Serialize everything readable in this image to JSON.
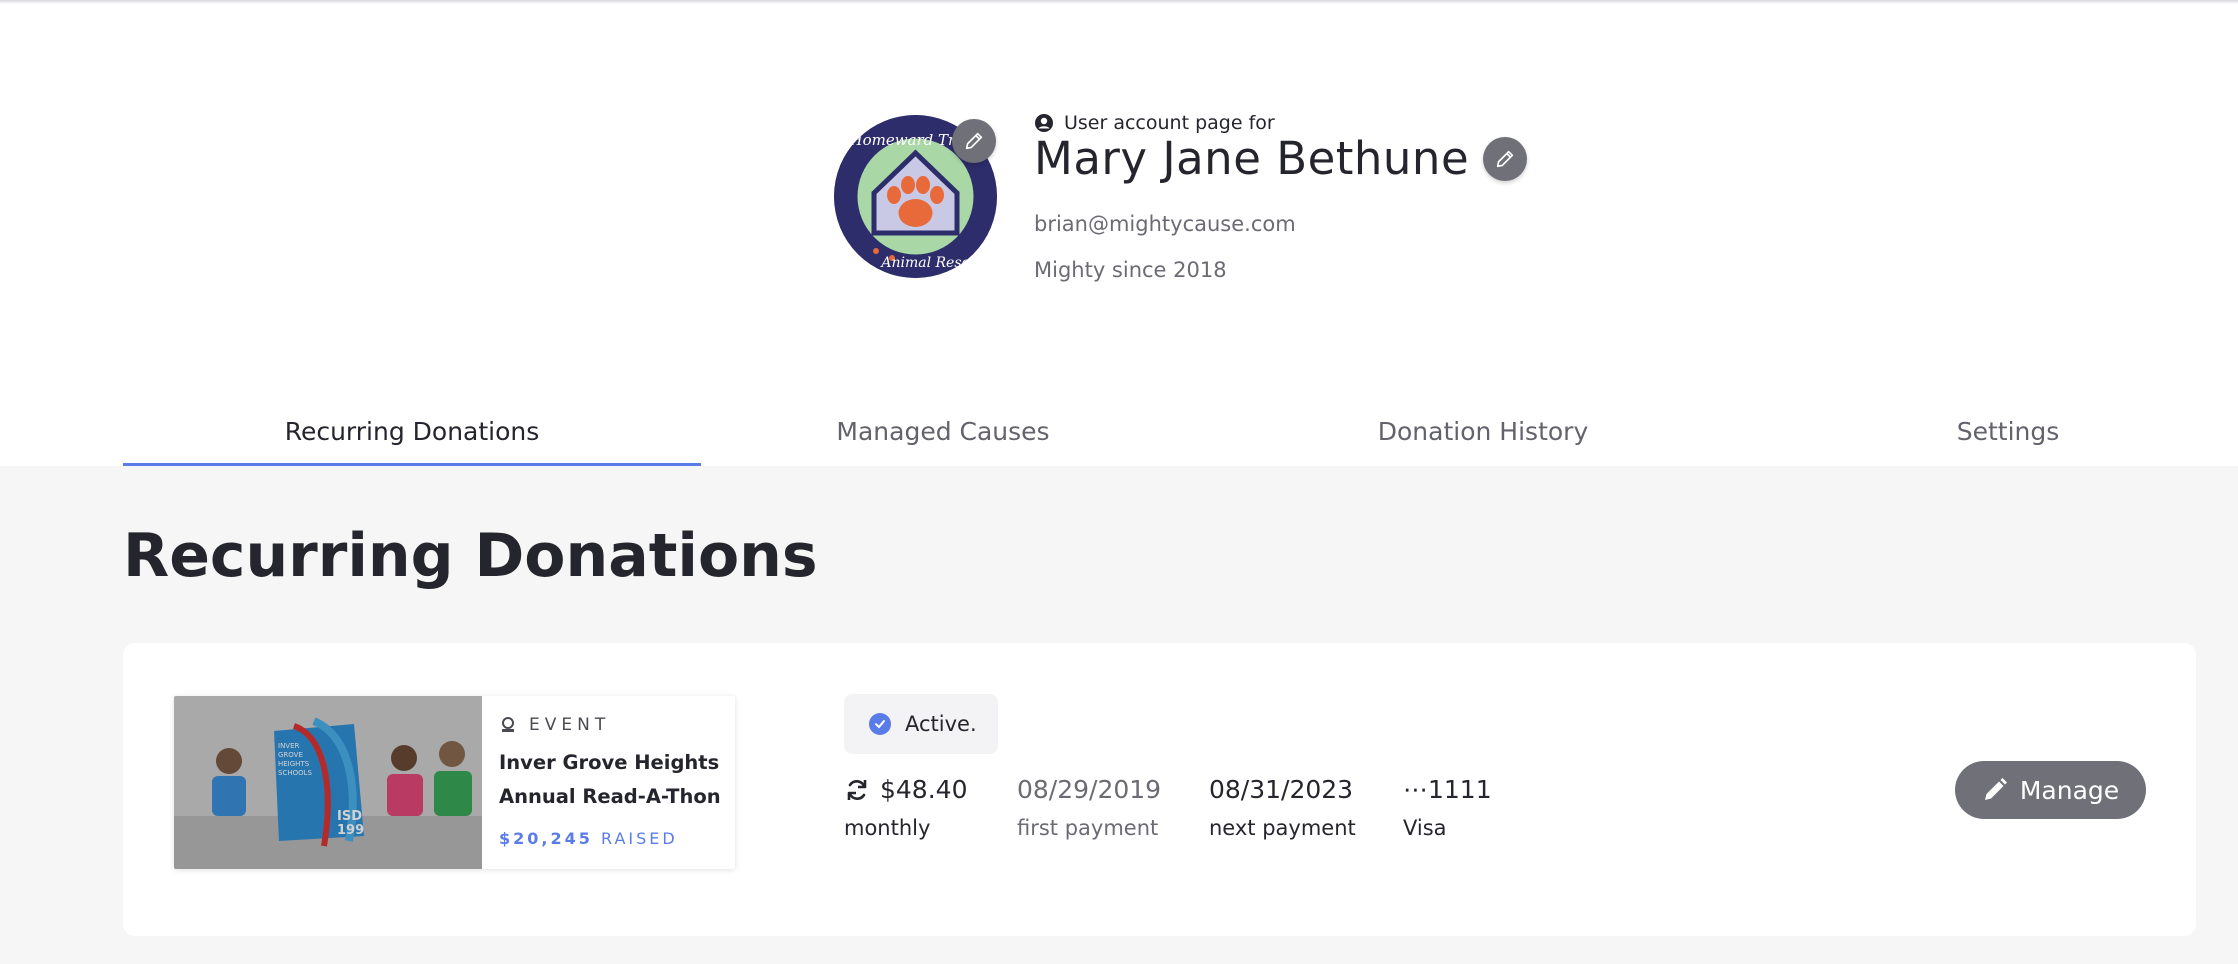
{
  "profile": {
    "account_label": "User account page for",
    "name": "Mary Jane Bethune",
    "email": "brian@mightycause.com",
    "member_since": "Mighty since 2018",
    "avatar_logo_text_top": "Homeward Trails",
    "avatar_logo_text_bottom": "Animal Rescue"
  },
  "tabs": [
    {
      "label": "Recurring Donations",
      "active": true
    },
    {
      "label": "Managed Causes",
      "active": false
    },
    {
      "label": "Donation History",
      "active": false
    },
    {
      "label": "Settings",
      "active": false
    }
  ],
  "main": {
    "title": "Recurring Donations",
    "donations": [
      {
        "cause_type": "EVENT",
        "cause_name": "Inver Grove Heights Annual Read-A-Thon",
        "raised_amount": "$20,245",
        "raised_label": "RAISED",
        "image_text": {
          "line1": "INVER",
          "line2": "GROVE",
          "line3": "HEIGHTS",
          "line4": "SCHOOLS",
          "badge_line1": "ISD",
          "badge_line2": "199"
        },
        "status": "Active.",
        "amount": "$48.40",
        "frequency": "monthly",
        "first_payment_date": "08/29/2019",
        "first_payment_label": "first payment",
        "next_payment_date": "08/31/2023",
        "next_payment_label": "next payment",
        "card_last4": "⋯1111",
        "card_brand": "Visa",
        "manage_label": "Manage"
      }
    ]
  },
  "colors": {
    "accent": "#5a7ce8",
    "text": "#25252d",
    "muted": "#6b6b74",
    "button": "#707078",
    "background_main": "#f6f6f6"
  },
  "icons": {
    "account": "user-circle-icon",
    "edit": "pencil-icon",
    "event": "event-icon",
    "status": "check-circle-icon",
    "recurring": "refresh-icon"
  }
}
